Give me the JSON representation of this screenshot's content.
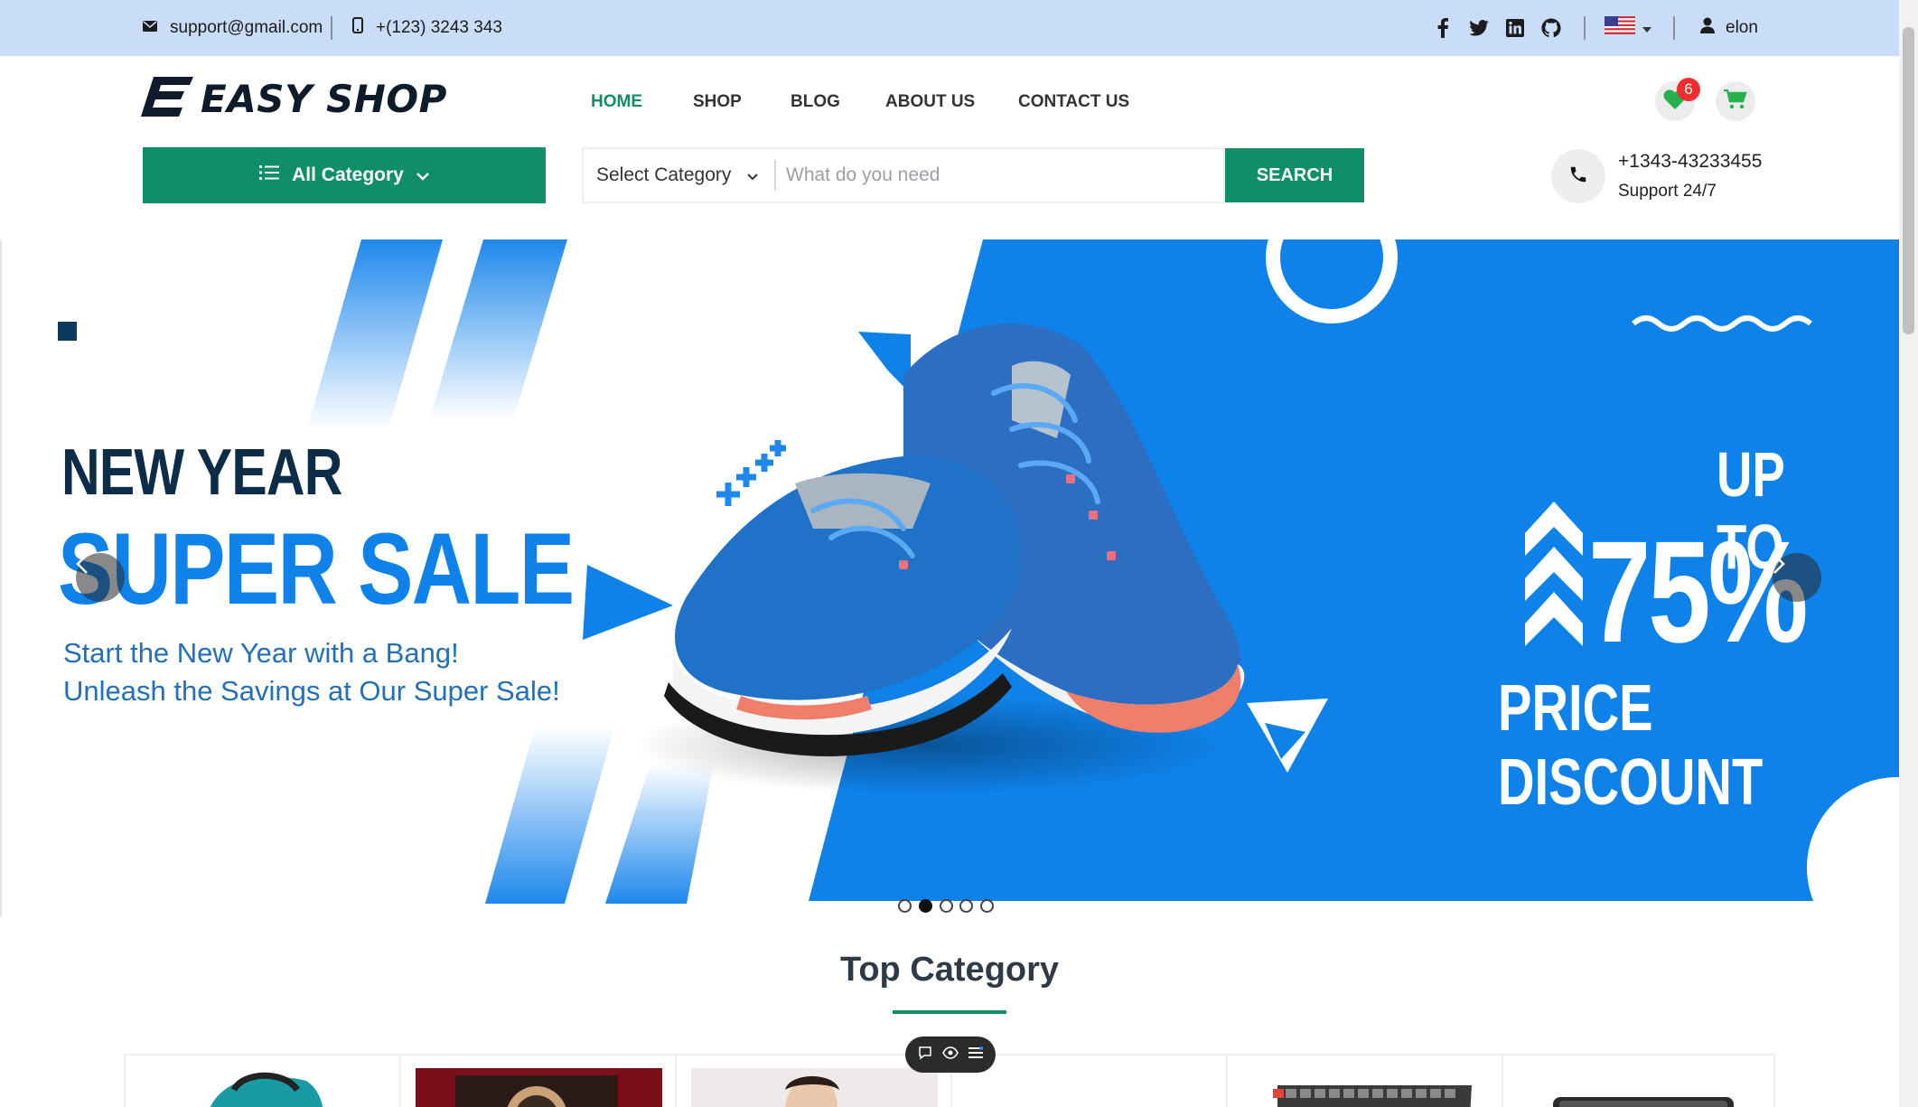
{
  "topbar": {
    "email": "support@gmail.com",
    "phone": "+(123) 3243 343",
    "social_icons": [
      "facebook-icon",
      "twitter-icon",
      "linkedin-icon",
      "github-icon"
    ],
    "language_flag": "us-flag-icon",
    "user_name": "elon"
  },
  "header": {
    "logo_text": "EASY SHOP",
    "nav": [
      "HOME",
      "SHOP",
      "BLOG",
      "ABOUT US",
      "CONTACT US"
    ],
    "active_nav": "HOME",
    "wishlist_count": "6",
    "accent_color": "#0f8e68"
  },
  "search": {
    "all_category_label": "All Category",
    "select_category_label": "Select Category",
    "placeholder": "What do you need",
    "button_label": "SEARCH"
  },
  "support": {
    "phone": "+1343-43233455",
    "label": "Support 24/7"
  },
  "banner": {
    "line1": "NEW YEAR",
    "line2": "SUPER SALE",
    "sub1": "Start the New Year with a Bang!",
    "sub2": "Unleash the Savings at Our Super Sale!",
    "up_to": "UP TO",
    "percent": "75%",
    "discount": "PRICE DISCOUNT",
    "slides": 5,
    "active_slide": 2,
    "brand_blue": "#0f82ea",
    "dark_navy": "#0d2c47"
  },
  "top_category": {
    "title": "Top Category"
  }
}
